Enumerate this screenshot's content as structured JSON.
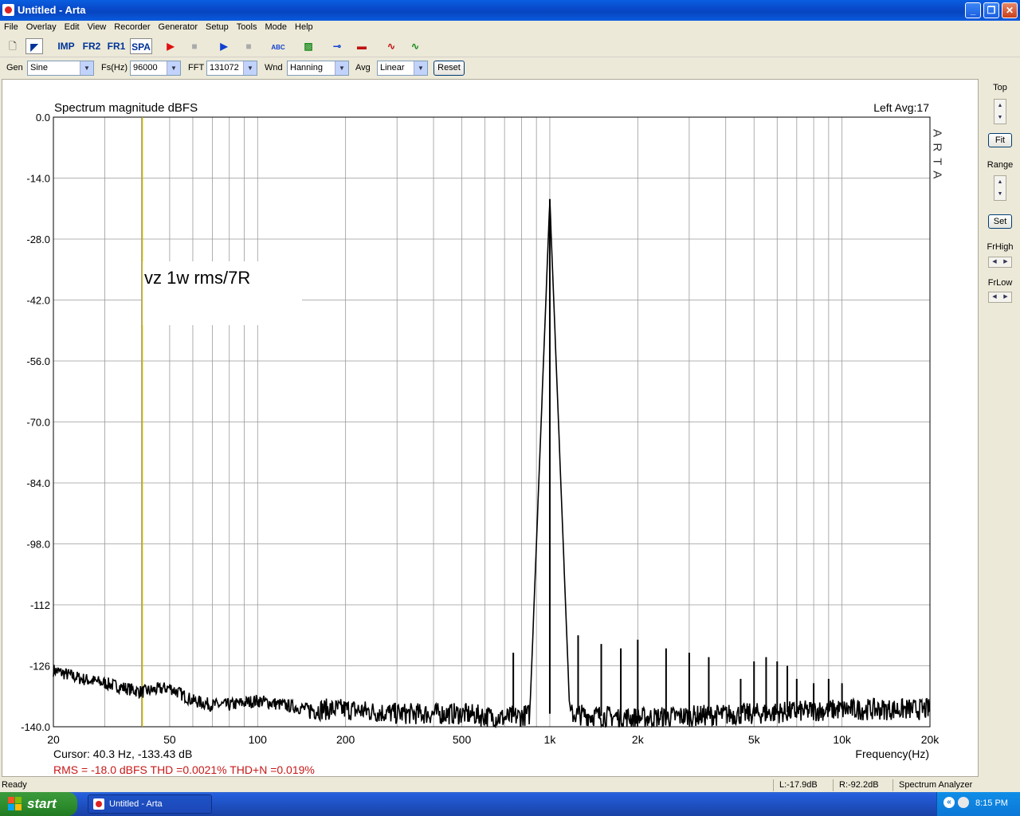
{
  "window": {
    "title": "Untitled - Arta"
  },
  "menu": [
    "File",
    "Overlay",
    "Edit",
    "View",
    "Recorder",
    "Generator",
    "Setup",
    "Tools",
    "Mode",
    "Help"
  ],
  "toolbar": {
    "imp": "IMP",
    "fr2": "FR2",
    "fr1": "FR1",
    "spa": "SPA"
  },
  "controls": {
    "gen_label": "Gen",
    "gen_value": "Sine",
    "fs_label": "Fs(Hz)",
    "fs_value": "96000",
    "fft_label": "FFT",
    "fft_value": "131072",
    "wnd_label": "Wnd",
    "wnd_value": "Hanning",
    "avg_label": "Avg",
    "avg_value": "Linear",
    "reset": "Reset"
  },
  "right_panel": {
    "top": "Top",
    "fit": "Fit",
    "range": "Range",
    "set": "Set",
    "frhigh": "FrHigh",
    "frlow": "FrLow"
  },
  "plot": {
    "title": "Spectrum magnitude dBFS",
    "channel_info": "Left  Avg:17",
    "watermark": "A R T A",
    "annotation": "vz 1w rms/7R",
    "xlabel": "Frequency(Hz)",
    "cursor": "Cursor:   40.3 Hz, -133.43 dB",
    "measurements": "RMS =  -18.0 dBFS   THD =0.0021%   THD+N =0.019%"
  },
  "chart_data": {
    "type": "line",
    "title": "Spectrum magnitude dBFS",
    "xlabel": "Frequency(Hz)",
    "ylabel": "",
    "x_scale": "log",
    "xlim": [
      20,
      20000
    ],
    "ylim": [
      -140,
      0
    ],
    "xticks": [
      {
        "v": 20,
        "label": "20"
      },
      {
        "v": 50,
        "label": "50"
      },
      {
        "v": 100,
        "label": "100"
      },
      {
        "v": 200,
        "label": "200"
      },
      {
        "v": 500,
        "label": "500"
      },
      {
        "v": 1000,
        "label": "1k"
      },
      {
        "v": 2000,
        "label": "2k"
      },
      {
        "v": 5000,
        "label": "5k"
      },
      {
        "v": 10000,
        "label": "10k"
      },
      {
        "v": 20000,
        "label": "20k"
      }
    ],
    "yticks": [
      "0.0",
      "-14.0",
      "-28.0",
      "-42.0",
      "-56.0",
      "-70.0",
      "-84.0",
      "-98.0",
      "-112",
      "-126",
      "-140.0"
    ],
    "grid": true,
    "cursor_x": 40.3,
    "noise_floor": [
      [
        20,
        -127
      ],
      [
        25,
        -129
      ],
      [
        30,
        -130
      ],
      [
        40,
        -132
      ],
      [
        50,
        -131
      ],
      [
        60,
        -134
      ],
      [
        70,
        -135
      ],
      [
        80,
        -135
      ],
      [
        100,
        -134
      ],
      [
        150,
        -136
      ],
      [
        200,
        -136
      ],
      [
        300,
        -137
      ],
      [
        500,
        -137
      ],
      [
        700,
        -138
      ],
      [
        900,
        -137
      ],
      [
        1100,
        -137
      ],
      [
        2000,
        -138
      ],
      [
        5000,
        -137
      ],
      [
        10000,
        -136
      ],
      [
        20000,
        -136
      ]
    ],
    "peaks": [
      {
        "f": 750,
        "db": -123
      },
      {
        "f": 1000,
        "db": -18.8
      },
      {
        "f": 1250,
        "db": -119
      },
      {
        "f": 1500,
        "db": -121
      },
      {
        "f": 1750,
        "db": -122
      },
      {
        "f": 2000,
        "db": -120
      },
      {
        "f": 2500,
        "db": -122
      },
      {
        "f": 3000,
        "db": -123
      },
      {
        "f": 3500,
        "db": -124
      },
      {
        "f": 4500,
        "db": -129
      },
      {
        "f": 5000,
        "db": -125
      },
      {
        "f": 5500,
        "db": -124
      },
      {
        "f": 6000,
        "db": -125
      },
      {
        "f": 6500,
        "db": -126
      },
      {
        "f": 7000,
        "db": -129
      },
      {
        "f": 8000,
        "db": -130
      },
      {
        "f": 9000,
        "db": -129
      },
      {
        "f": 10000,
        "db": -130
      }
    ]
  },
  "statusbar": {
    "ready": "Ready",
    "left_level": "L:-17.9dB",
    "right_level": "R:-92.2dB",
    "mode": "Spectrum Analyzer"
  },
  "taskbar": {
    "start": "start",
    "task": "Untitled - Arta",
    "time": "8:15 PM"
  }
}
